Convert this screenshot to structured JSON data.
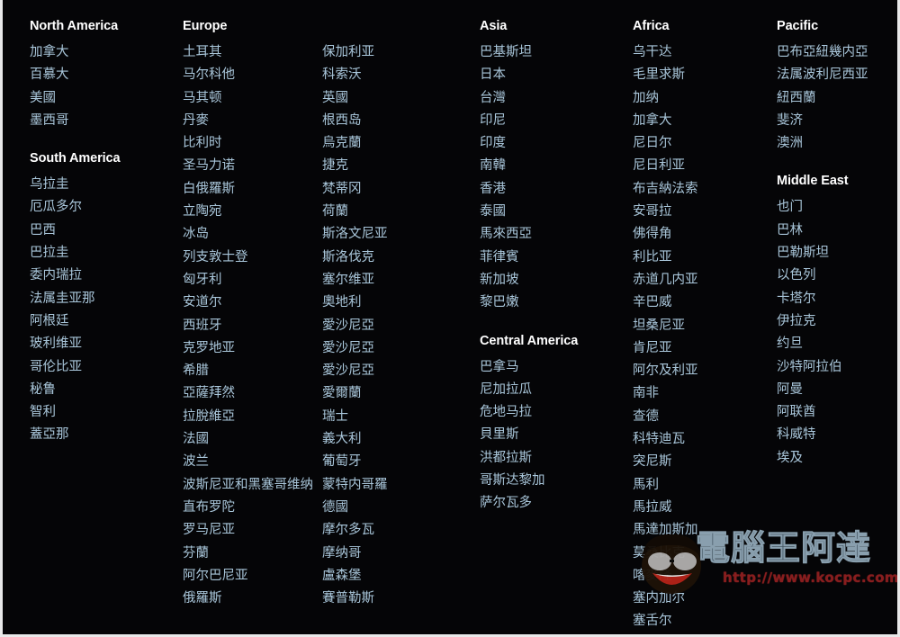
{
  "page": {
    "background_color": "#050507",
    "link_color": "#a9c6da",
    "heading_color": "#ffffff"
  },
  "columns": [
    {
      "id": "north-south-america",
      "groups": [
        {
          "title": "North America",
          "countries": [
            "加拿大",
            "百慕大",
            "美國",
            "墨西哥"
          ]
        },
        {
          "title": "South America",
          "countries": [
            "乌拉圭",
            "厄瓜多尔",
            "巴西",
            "巴拉圭",
            "委内瑞拉",
            "法属圭亚那",
            "阿根廷",
            "玻利维亚",
            "哥伦比亚",
            "秘鲁",
            "智利",
            "蓋亞那"
          ]
        }
      ]
    },
    {
      "id": "europe-column-1",
      "groups": [
        {
          "title": "Europe",
          "countries": [
            "土耳其",
            "马尔科他",
            "马其顿",
            "丹麥",
            "比利时",
            "圣马力诺",
            "白俄羅斯",
            "立陶宛",
            "冰岛",
            "列支敦士登",
            "匈牙利",
            "安道尔",
            "西班牙",
            "克罗地亚",
            "希腊",
            "亞薩拜然",
            "拉脫維亞",
            "法國",
            "波兰",
            "波斯尼亚和黑塞哥维纳",
            "直布罗陀",
            "罗马尼亚",
            "芬蘭",
            "阿尔巴尼亚",
            "俄羅斯"
          ]
        }
      ]
    },
    {
      "id": "europe-column-2",
      "groups": [
        {
          "title": "",
          "countries": [
            "保加利亚",
            "科索沃",
            "英國",
            "根西岛",
            "烏克蘭",
            "捷克",
            "梵蒂冈",
            "荷蘭",
            "斯洛文尼亚",
            "斯洛伐克",
            "塞尔维亚",
            "奧地利",
            "愛沙尼亞",
            "愛沙尼亞",
            "愛沙尼亞",
            "愛爾蘭",
            "瑞士",
            "義大利",
            "葡萄牙",
            "蒙特内哥羅",
            "德國",
            "摩尔多瓦",
            "摩纳哥",
            "盧森堡",
            "賽普勒斯"
          ]
        }
      ]
    },
    {
      "id": "asia-central-america",
      "groups": [
        {
          "title": "Asia",
          "countries": [
            "巴基斯坦",
            "日本",
            "台灣",
            "印尼",
            "印度",
            "南韓",
            "香港",
            "泰國",
            "馬來西亞",
            "菲律賓",
            "新加坡",
            "黎巴嫩"
          ]
        },
        {
          "title": "Central America",
          "countries": [
            "巴拿马",
            "尼加拉瓜",
            "危地马拉",
            "貝里斯",
            "洪都拉斯",
            "哥斯达黎加",
            "萨尔瓦多"
          ]
        }
      ]
    },
    {
      "id": "africa",
      "groups": [
        {
          "title": "Africa",
          "countries": [
            "乌干达",
            "毛里求斯",
            "加纳",
            "加拿大",
            "尼日尔",
            "尼日利亚",
            "布吉納法索",
            "安哥拉",
            "佛得角",
            "利比亚",
            "赤道几内亚",
            "辛巴威",
            "坦桑尼亚",
            "肯尼亚",
            "阿尔及利亚",
            "南非",
            "查德",
            "科特迪瓦",
            "突尼斯",
            "馬利",
            "馬拉威",
            "馬達加斯加",
            "莫桑比克",
            "喀麥隆",
            "塞内加尔",
            "塞舌尔"
          ]
        }
      ]
    },
    {
      "id": "pacific-middle-east",
      "groups": [
        {
          "title": "Pacific",
          "countries": [
            "巴布亞紐幾内亞",
            "法属波利尼西亚",
            "紐西蘭",
            "斐济",
            "澳洲"
          ]
        },
        {
          "title": "Middle East",
          "countries": [
            "也门",
            "巴林",
            "巴勒斯坦",
            "以色列",
            "卡塔尔",
            "伊拉克",
            "约旦",
            "沙特阿拉伯",
            "阿曼",
            "阿联酋",
            "科威特",
            "埃及"
          ]
        }
      ]
    }
  ],
  "watermark": {
    "brand": "電腦王阿達",
    "url": "http://www.kocpc.com.tw"
  }
}
